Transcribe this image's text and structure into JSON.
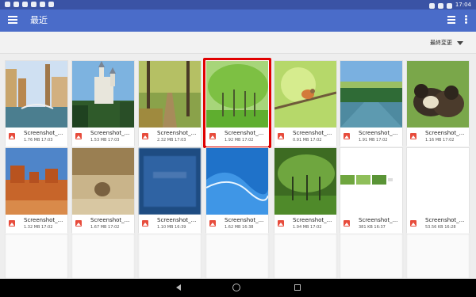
{
  "status_bar": {
    "time": "17:04"
  },
  "app_bar": {
    "title": "最近"
  },
  "sort": {
    "label": "最終変更"
  },
  "files": [
    {
      "name": "Screenshot_...",
      "meta": "1.76 MB 17:03",
      "thumb": "venice-canal"
    },
    {
      "name": "Screenshot_...",
      "meta": "1.53 MB 17:03",
      "thumb": "castle"
    },
    {
      "name": "Screenshot_...",
      "meta": "2.32 MB 17:03",
      "thumb": "autumn-path"
    },
    {
      "name": "Screenshot_...",
      "meta": "1.92 MB 17:02",
      "thumb": "green-trees",
      "selected": true
    },
    {
      "name": "Screenshot_...",
      "meta": "0.91 MB 17:02",
      "thumb": "bird-branch"
    },
    {
      "name": "Screenshot_...",
      "meta": "1.91 MB 17:02",
      "thumb": "canal-river"
    },
    {
      "name": "Screenshot_...",
      "meta": "1.16 MB 17:02",
      "thumb": "ducklings"
    },
    {
      "name": "Screenshot_...",
      "meta": "1.32 MB 17:02",
      "thumb": "desert-butte"
    },
    {
      "name": "Screenshot_...",
      "meta": "1.67 MB 17:02",
      "thumb": "rock-hamster"
    },
    {
      "name": "Screenshot_...",
      "meta": "1.10 MB 16:39",
      "thumb": "blurred-blue"
    },
    {
      "name": "Screenshot_...",
      "meta": "1.62 MB 16:38",
      "thumb": "blue-waves"
    },
    {
      "name": "Screenshot_...",
      "meta": "1.94 MB 17:02",
      "thumb": "trees-small"
    },
    {
      "name": "Screenshot_...",
      "meta": "381 KB 16:37",
      "thumb": "white-strip"
    },
    {
      "name": "Screenshot_...",
      "meta": "53.56 KB 16:28",
      "thumb": "white"
    }
  ]
}
